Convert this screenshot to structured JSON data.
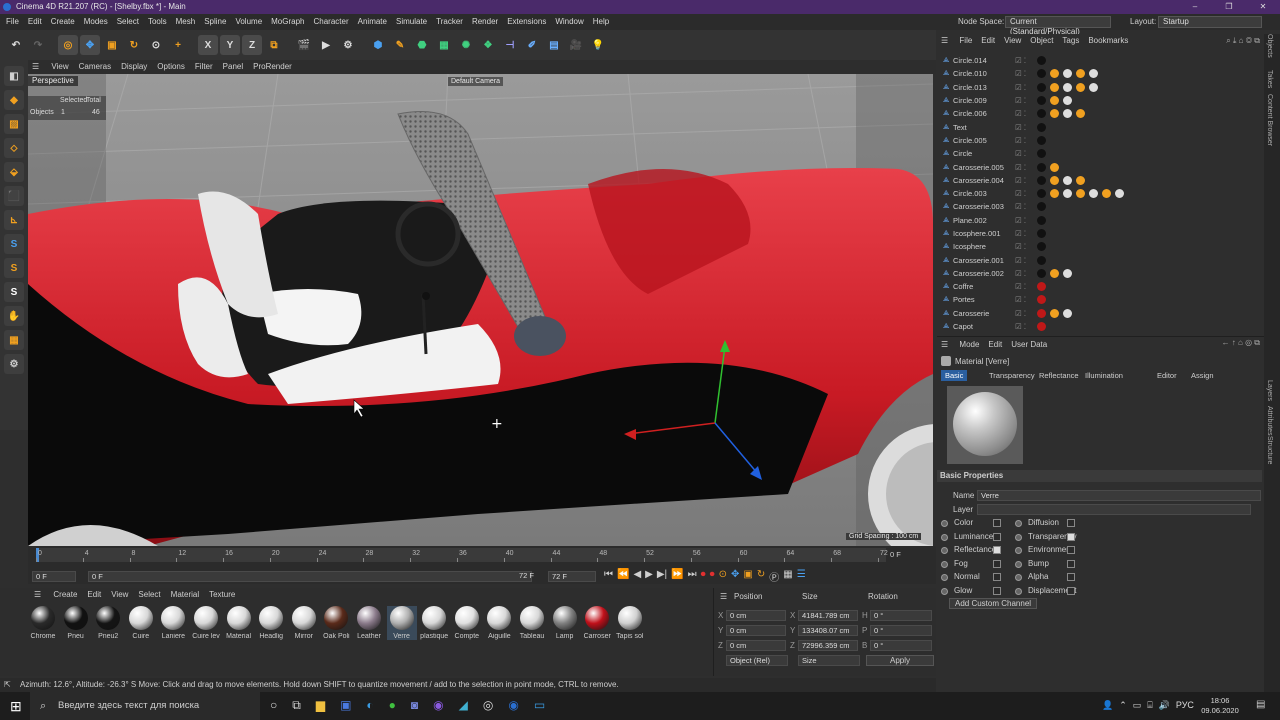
{
  "app": {
    "title": "Cinema 4D R21.207 (RC) - [Shelby.fbx *] - Main"
  },
  "menubar": {
    "items": [
      "File",
      "Edit",
      "Create",
      "Modes",
      "Select",
      "Tools",
      "Mesh",
      "Spline",
      "Volume",
      "MoGraph",
      "Character",
      "Animate",
      "Simulate",
      "Tracker",
      "Render",
      "Extensions",
      "Window",
      "Help"
    ],
    "node_space_label": "Node Space:",
    "node_space_value": "Current (Standard/Physical)",
    "layout_label": "Layout:",
    "layout_value": "Startup"
  },
  "viewport": {
    "menu": [
      "View",
      "Cameras",
      "Display",
      "Options",
      "Filter",
      "Panel",
      "ProRender"
    ],
    "projection": "Perspective",
    "camera": "Default Camera",
    "grid_spacing": "Grid Spacing : 100 cm",
    "stats": {
      "selected_label": "Selected",
      "total_label": "Total",
      "objects_label": "Objects",
      "objects_selected": "1",
      "objects_total": "46"
    }
  },
  "timeline": {
    "ticks": [
      "0",
      "4",
      "8",
      "12",
      "16",
      "20",
      "24",
      "28",
      "32",
      "36",
      "40",
      "44",
      "48",
      "52",
      "56",
      "60",
      "64",
      "68",
      "72"
    ],
    "current_frame": "0 F",
    "start_field": "0 F",
    "start_field2": "0 F",
    "end_field": "72 F",
    "end_field2": "72 F"
  },
  "materials": {
    "menu": [
      "Create",
      "Edit",
      "View",
      "Select",
      "Material",
      "Texture"
    ],
    "items": [
      {
        "name": "Chrome",
        "color": "#2a2a2a"
      },
      {
        "name": "Pneu",
        "color": "#111111"
      },
      {
        "name": "Pneu2",
        "color": "#151515"
      },
      {
        "name": "Cuire",
        "color": "#d8d8d8"
      },
      {
        "name": "Laniere",
        "color": "#d8d8d8"
      },
      {
        "name": "Cuire lev",
        "color": "#d8d8d8"
      },
      {
        "name": "Material",
        "color": "#d8d8d8"
      },
      {
        "name": "Headlig",
        "color": "#d8d8d8"
      },
      {
        "name": "Mirror",
        "color": "#d8d8d8"
      },
      {
        "name": "Oak Poli",
        "color": "#5a2a1a"
      },
      {
        "name": "Leather",
        "color": "#8a7a8a"
      },
      {
        "name": "Verre",
        "color": "#b0b0b0"
      },
      {
        "name": "plastique",
        "color": "#d8d8d8"
      },
      {
        "name": "Compte",
        "color": "#e0e0e0"
      },
      {
        "name": "Aiguille",
        "color": "#d8d8d8"
      },
      {
        "name": "Tableau",
        "color": "#d8d8d8"
      },
      {
        "name": "Lamp",
        "color": "#808080"
      },
      {
        "name": "Carroser",
        "color": "#c0101a"
      },
      {
        "name": "Tapis sol",
        "color": "#d0d0d0"
      }
    ]
  },
  "coords": {
    "headers": [
      "Position",
      "Size",
      "Rotation"
    ],
    "rows": [
      {
        "axis": "X",
        "pos": "0 cm",
        "size_axis": "X",
        "size": "41841.789 cm",
        "rot_axis": "H",
        "rot": "0 °"
      },
      {
        "axis": "Y",
        "pos": "0 cm",
        "size_axis": "Y",
        "size": "133408.07 cm",
        "rot_axis": "P",
        "rot": "0 °"
      },
      {
        "axis": "Z",
        "pos": "0 cm",
        "size_axis": "Z",
        "size": "72996.359 cm",
        "rot_axis": "B",
        "rot": "0 °"
      }
    ],
    "mode_value": "Object (Rel)",
    "size_mode": "Size",
    "apply": "Apply"
  },
  "status": {
    "text": "Azimuth: 12.6°, Altitude: -26.3° S      Move: Click and drag to move elements. Hold down SHIFT to quantize movement / add to the selection in point mode, CTRL to remove."
  },
  "objects": {
    "menu": [
      "File",
      "Edit",
      "View",
      "Object",
      "Tags",
      "Bookmarks"
    ],
    "items": [
      "Circle.014",
      "Circle.010",
      "Circle.013",
      "Circle.009",
      "Circle.006",
      "Text",
      "Circle.005",
      "Circle",
      "Carosserie.005",
      "Carosserie.004",
      "Circle.003",
      "Carosserie.003",
      "Plane.002",
      "Icosphere.001",
      "Icosphere",
      "Carosserie.001",
      "Carosserie.002",
      "Coffre",
      "Portes",
      "Carosserie",
      "Capot"
    ]
  },
  "attributes": {
    "menu": [
      "Mode",
      "Edit",
      "User Data"
    ],
    "header": "Material [Verre]",
    "tabs": [
      "Basic",
      "Transparency",
      "Reflectance",
      "Illumination",
      "Editor",
      "Assign"
    ],
    "section": "Basic Properties",
    "name_label": "Name",
    "name_value": "Verre",
    "layer_label": "Layer",
    "channels_left": [
      {
        "label": "Color",
        "on": false
      },
      {
        "label": "Luminance",
        "on": false
      },
      {
        "label": "Reflectance",
        "on": true
      },
      {
        "label": "Fog",
        "on": false
      },
      {
        "label": "Normal",
        "on": false
      },
      {
        "label": "Glow",
        "on": false
      }
    ],
    "channels_right": [
      {
        "label": "Diffusion",
        "on": false
      },
      {
        "label": "Transparency",
        "on": true
      },
      {
        "label": "Environment",
        "on": false
      },
      {
        "label": "Bump",
        "on": false
      },
      {
        "label": "Alpha",
        "on": false
      },
      {
        "label": "Displacement",
        "on": false
      }
    ],
    "add_channel": "Add Custom Channel"
  },
  "side_tabs": [
    "Objects",
    "Takes",
    "Content Browser",
    "Layers",
    "Attributes",
    "Structure"
  ],
  "taskbar": {
    "search_placeholder": "Введите здесь текст для поиска",
    "lang": "РУС",
    "time": "18:06",
    "date": "09.06.2020"
  },
  "colors": {
    "title": "#4a2a6a",
    "accent": "#2a5fa0",
    "car_red": "#d0202a"
  }
}
